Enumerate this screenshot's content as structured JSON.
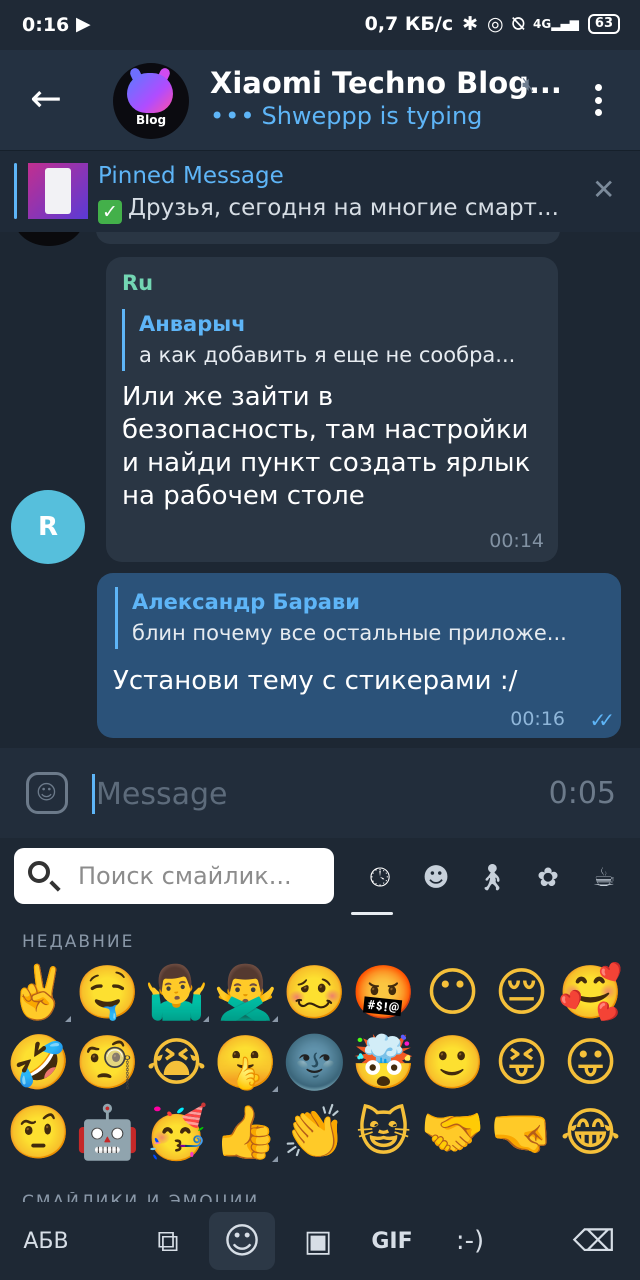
{
  "status_bar": {
    "time": "0:16",
    "network_speed": "0,7 КБ/с",
    "battery": "63",
    "signal": "4G"
  },
  "header": {
    "title": "Xiaomi Techno Blog...",
    "avatar_label": "Blog",
    "typing_text": "Shweppp is typing"
  },
  "pinned": {
    "title": "Pinned Message",
    "text": "Друзья, сегодня на многие смарт..."
  },
  "messages": [
    {
      "sender": "Ru",
      "avatar_letter": "R",
      "reply_name": "Анварыч",
      "reply_text": "а как добавить я еще не сообра...",
      "text": "Или же зайти в безопасность, там настройки и найди пункт создать ярлык на рабочем столе",
      "time": "00:14"
    },
    {
      "reply_name": "Александр Барави",
      "reply_text": "блин почему все остальные приложе...",
      "text": "Установи тему с стикерами :/",
      "time": "00:16"
    }
  ],
  "composer": {
    "placeholder": "Message",
    "record_time": "0:05"
  },
  "emoji_panel": {
    "search_placeholder": "Поиск смайлик...",
    "section_recent": "НЕДАВНИЕ",
    "section_next": "СМАЙЛИКИ И ЭМОЦИИ",
    "emojis": [
      "✌️",
      "🤤",
      "🤷‍♂️",
      "🙅‍♂️",
      "🥴",
      "🤬",
      "😶",
      "😔",
      "🥰",
      "🤣",
      "🧐",
      "😭",
      "🤫",
      "🌚",
      "🤯",
      "🙂",
      "😝",
      "😛",
      "🤨",
      "🤖",
      "🥳",
      "👍",
      "👏",
      "😺",
      "🤝",
      "🤜",
      "😂"
    ]
  },
  "keyboard": {
    "abc_label": "АБВ",
    "gif_label": "GIF",
    "emoticon_label": ":-)"
  }
}
